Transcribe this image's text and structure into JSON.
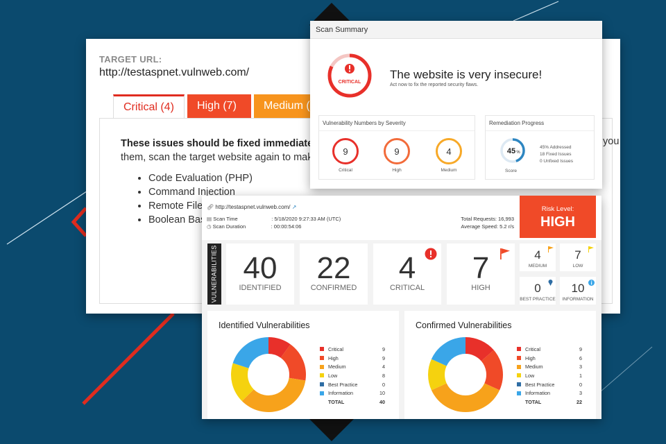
{
  "back_panel": {
    "target_label": "TARGET URL:",
    "target_url": "http://testaspnet.vulnweb.com/",
    "tabs": [
      {
        "label": "Critical (4)"
      },
      {
        "label": "High (7)"
      },
      {
        "label": "Medium ("
      }
    ],
    "fix_line1": "These issues should be fixed immediately",
    "fix_line2": "them, scan the target website again to make",
    "right_fragment": "you",
    "issues": [
      "Code Evaluation (PHP)",
      "Command Injection",
      "Remote File",
      "Boolean Bas"
    ]
  },
  "summary": {
    "header": "Scan Summary",
    "gauge_label": "CRITICAL",
    "title": "The website is very insecure!",
    "subtitle": "Act now to fix the reported security flaws.",
    "severity_box": {
      "title": "Vulnerability Numbers by Severity",
      "items": [
        {
          "value": "9",
          "label": "Critical",
          "color": "#e8302a"
        },
        {
          "value": "9",
          "label": "High",
          "color": "#f26b3a"
        },
        {
          "value": "4",
          "label": "Medium",
          "color": "#f7a928"
        }
      ]
    },
    "remediation": {
      "title": "Remediation Progress",
      "score_text": "45",
      "score_unit": "%",
      "score_fraction": 0.45,
      "score_label": "Score",
      "lines": [
        "45% Addressed",
        "18 Fixed Issues",
        "0 Unfixed Issues"
      ]
    }
  },
  "dashboard": {
    "url": "http://testaspnet.vulnweb.com/",
    "scan_time_label": "Scan Time",
    "scan_time_value": ": 5/18/2020 9:27:33 AM (UTC)",
    "scan_duration_label": "Scan Duration",
    "scan_duration_value": ": 00:00:54:06",
    "total_requests": "Total Requests: 16,993",
    "average_speed": "Average Speed: 5.2 r/s",
    "risk_label": "Risk Level:",
    "risk_value": "HIGH",
    "vuln_side_label": "VULNERABILITIES",
    "cards": [
      {
        "value": "40",
        "label": "IDENTIFIED"
      },
      {
        "value": "22",
        "label": "CONFIRMED"
      },
      {
        "value": "4",
        "label": "CRITICAL"
      },
      {
        "value": "7",
        "label": "HIGH"
      }
    ],
    "minis": [
      {
        "value": "4",
        "label": "MEDIUM"
      },
      {
        "value": "7",
        "label": "LOW"
      },
      {
        "value": "0",
        "label": "BEST PRACTICE"
      },
      {
        "value": "10",
        "label": "INFORMATION"
      }
    ]
  },
  "colors": {
    "critical": "#e8302a",
    "high": "#f04a28",
    "medium": "#f7a21b",
    "low": "#f5d20f",
    "best_practice": "#2e6da4",
    "information": "#3aa6e8"
  },
  "chart_data": [
    {
      "type": "pie",
      "title": "Identified Vulnerabilities",
      "categories": [
        "Critical",
        "High",
        "Medium",
        "Low",
        "Best Practice",
        "Information"
      ],
      "values": [
        9,
        9,
        4,
        8,
        0,
        10
      ],
      "slice_values": [
        4,
        7,
        14,
        7,
        0,
        8
      ],
      "total_label": "TOTAL",
      "total": 40
    },
    {
      "type": "pie",
      "title": "Confirmed Vulnerabilities",
      "categories": [
        "Critical",
        "High",
        "Medium",
        "Low",
        "Best Practice",
        "Information"
      ],
      "values": [
        9,
        6,
        3,
        1,
        0,
        3
      ],
      "slice_values": [
        3,
        4,
        8,
        3,
        0,
        4
      ],
      "total_label": "TOTAL",
      "total": 22
    }
  ]
}
